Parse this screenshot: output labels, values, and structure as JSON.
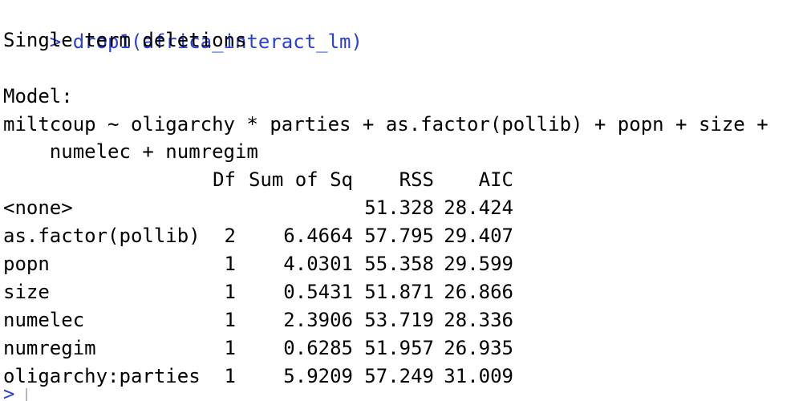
{
  "console": {
    "command_prompt": ">",
    "command": "drop1(africa_interact_lm)",
    "heading": "Single term deletions",
    "model_label": "Model:",
    "formula_line1": "miltcoup ~ oligarchy * parties + as.factor(pollib) + popn + size +",
    "formula_line2": "    numelec + numregim",
    "table": {
      "headers": [
        "",
        "Df",
        "Sum of Sq",
        "RSS",
        "AIC"
      ],
      "rows": [
        {
          "term": "<none>",
          "df": "",
          "sumsq": "",
          "rss": "51.328",
          "aic": "28.424"
        },
        {
          "term": "as.factor(pollib)",
          "df": "2",
          "sumsq": "6.4664",
          "rss": "57.795",
          "aic": "29.407"
        },
        {
          "term": "popn",
          "df": "1",
          "sumsq": "4.0301",
          "rss": "55.358",
          "aic": "29.599"
        },
        {
          "term": "size",
          "df": "1",
          "sumsq": "0.5431",
          "rss": "51.871",
          "aic": "26.866"
        },
        {
          "term": "numelec",
          "df": "1",
          "sumsq": "2.3906",
          "rss": "53.719",
          "aic": "28.336"
        },
        {
          "term": "numregim",
          "df": "1",
          "sumsq": "0.6285",
          "rss": "51.957",
          "aic": "26.935"
        },
        {
          "term": "oligarchy:parties",
          "df": "1",
          "sumsq": "5.9209",
          "rss": "57.249",
          "aic": "31.009"
        }
      ]
    },
    "next_prompt": ">"
  }
}
